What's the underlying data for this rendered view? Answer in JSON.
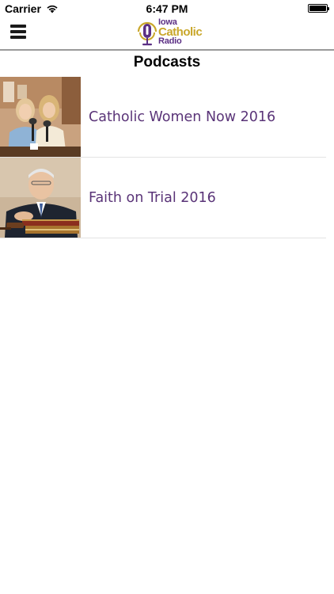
{
  "status_bar": {
    "carrier": "Carrier",
    "time": "6:47 PM",
    "battery_level": 1.0
  },
  "nav": {
    "menu_icon": "hamburger-menu-icon",
    "logo": {
      "line1": "Iowa",
      "line2": "Catholic",
      "line3": "Radio",
      "colors": {
        "purple": "#5b2f84",
        "gold": "#c9a72b"
      }
    }
  },
  "page": {
    "title": "Podcasts"
  },
  "podcasts": [
    {
      "title": "Catholic Women Now 2016",
      "thumbnail": "two-women-hosts-photo"
    },
    {
      "title": "Faith on Trial 2016",
      "thumbnail": "man-with-books-and-gavel-photo"
    }
  ],
  "colors": {
    "link_purple": "#5a3478",
    "divider": "#9a9a9a"
  }
}
